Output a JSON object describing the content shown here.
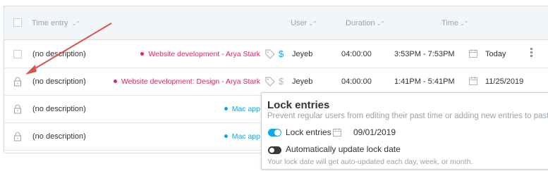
{
  "header": {
    "time_entry": "Time entry",
    "user": "User",
    "duration": "Duration",
    "time": "Time",
    "sort_glyph": "⌄⌃"
  },
  "rows": [
    {
      "locked": false,
      "description": "(no description)",
      "project": "Website development - Arya Stark",
      "project_color": "#e91e63",
      "billable_color": "#03a9f4",
      "user": "Jeyeb",
      "duration": "04:00:00",
      "time_range": "3:53PM - 7:53PM",
      "date": "Today"
    },
    {
      "locked": true,
      "description": "(no description)",
      "project": "Website development: Design - Arya Stark",
      "project_color": "#e91e63",
      "billable_color": "#b0b8bf",
      "user": "Jeyeb",
      "duration": "04:00:00",
      "time_range": "1:41PM - 5:41PM",
      "date": "11/25/2019"
    },
    {
      "locked": true,
      "description": "(no description)",
      "project": "Mac app",
      "project_color": "#03a9f4"
    },
    {
      "locked": true,
      "description": "(no description)",
      "project": "Mac app",
      "project_color": "#03a9f4"
    }
  ],
  "popover": {
    "title": "Lock entries",
    "description": "Prevent regular users from editing their past time or adding new entries to past dates.",
    "lock_label": "Lock entries",
    "lock_enabled": true,
    "lock_date": "09/01/2019",
    "auto_update_label": "Automatically update lock date",
    "auto_update_enabled": false,
    "note": "Your lock date will get auto-updated each day, week, or month."
  },
  "colors": {
    "accent": "#03a9f4",
    "pink": "#e91e63",
    "annotation_arrow": "#d9534f"
  },
  "icons": [
    "checkbox-icon",
    "sort-icon",
    "tag-icon",
    "dollar-icon",
    "calendar-icon",
    "lock-icon",
    "kebab-menu-icon",
    "annotation-arrow"
  ]
}
